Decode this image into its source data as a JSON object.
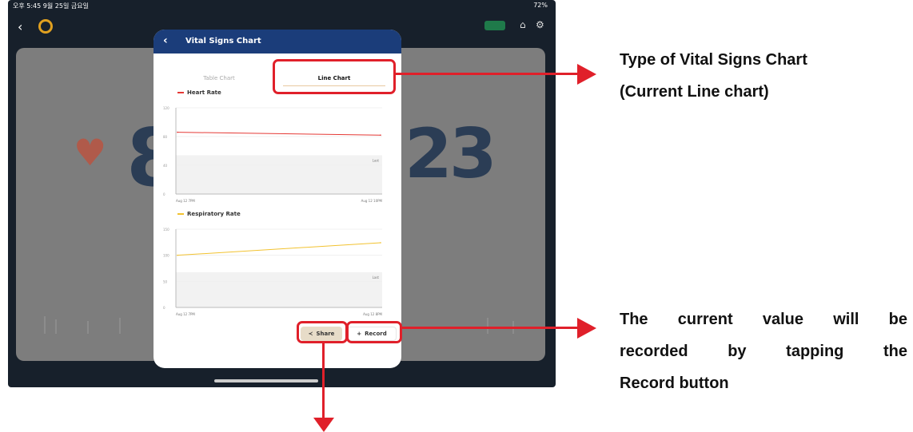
{
  "status_bar": {
    "time": "오후 5:45  9월 25일 금요일",
    "battery": "72%"
  },
  "monitor": {
    "left_value": "8",
    "right_value": "23"
  },
  "modal": {
    "title": "Vital Signs Chart",
    "tabs": [
      {
        "label": "Table Chart",
        "active": false
      },
      {
        "label": "Line Chart",
        "active": true
      }
    ]
  },
  "charts": [
    {
      "legend": "Heart Rate",
      "color": "#e53935",
      "y_ticks": [
        "120",
        "80",
        "40",
        "0"
      ],
      "x_labels": [
        "Aug 12 7PM",
        "Aug 12 10PM"
      ],
      "tag": "Last"
    },
    {
      "legend": "Respiratory Rate",
      "color": "#f2c230",
      "y_ticks": [
        "150",
        "100",
        "50",
        "0"
      ],
      "x_labels": [
        "Aug 12 7PM",
        "Aug 12 8PM"
      ],
      "tag": "Last"
    }
  ],
  "buttons": {
    "share": "Share",
    "record": "Record"
  },
  "annotations": {
    "chart_type_lines": [
      "Type of Vital Signs Chart",
      "(Current Line chart)"
    ],
    "record_lines": [
      "The current value will be",
      "recorded by tapping the",
      "Record button"
    ]
  },
  "colors": {
    "highlight": "#e0202a",
    "header": "#1b3d7a"
  },
  "chart_data": [
    {
      "type": "line",
      "x": [
        "Aug 12 7PM",
        "Aug 12 10PM"
      ],
      "series": [
        {
          "name": "Heart Rate",
          "values": [
            86,
            82
          ]
        }
      ],
      "ylim": [
        0,
        120
      ]
    },
    {
      "type": "line",
      "x": [
        "Aug 12 7PM",
        "Aug 12 8PM"
      ],
      "series": [
        {
          "name": "Respiratory Rate",
          "values": [
            100,
            124
          ]
        }
      ],
      "ylim": [
        0,
        150
      ]
    }
  ]
}
